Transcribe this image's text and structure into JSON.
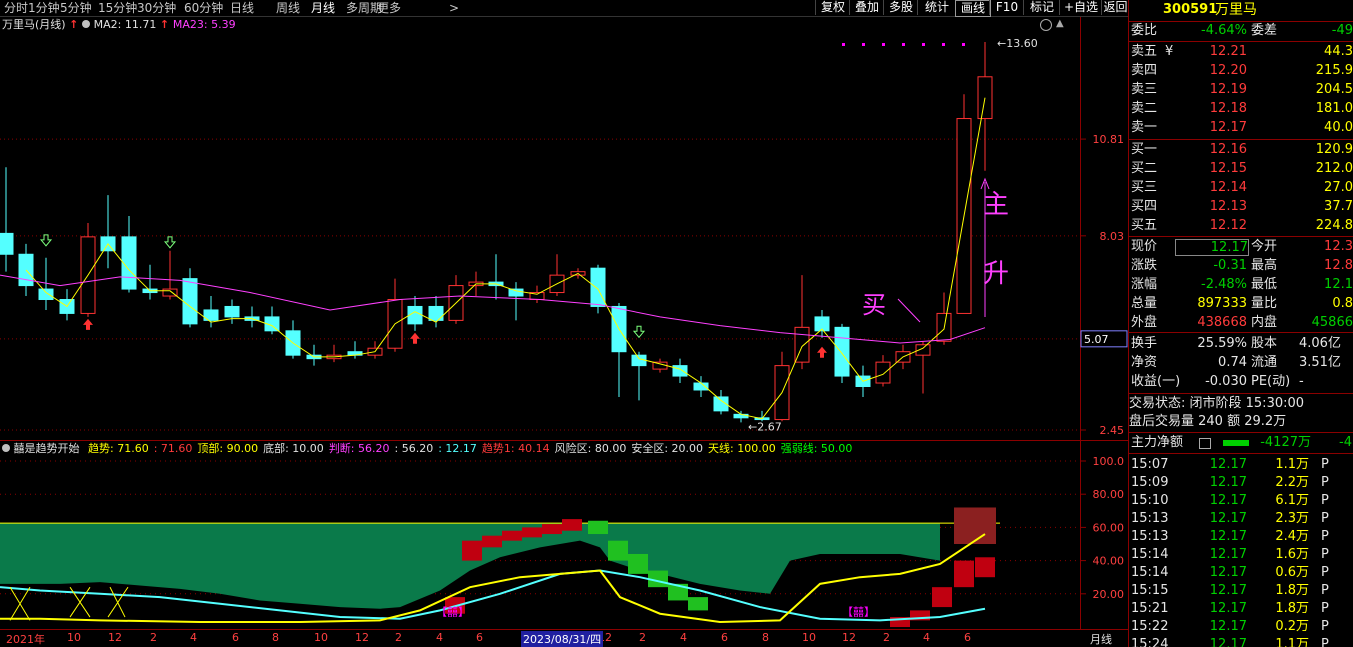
{
  "toolbar": {
    "periods": [
      "分时",
      "1分钟",
      "5分钟",
      "15分钟",
      "30分钟",
      "60分钟",
      "日线",
      "周线",
      "月线",
      "多周期",
      "更多"
    ],
    "selected_period": "月线",
    "right_buttons": [
      "复权",
      "叠加",
      "多股",
      "统计",
      "画线",
      "F10",
      "标记",
      "+自选",
      "返回"
    ],
    "selected_right": "画线"
  },
  "main_chart": {
    "stock_title": "万里马(月线)",
    "ma2_label": "MA2: 11.71",
    "ma23_label": "MA23: 5.39",
    "y_ticks": [
      "10.81",
      "8.03",
      "5.07",
      "2.45"
    ],
    "current_price_tag": "5.07",
    "high_label": "13.60",
    "low_label": "2.67",
    "annotation_buy": "买",
    "annotation_zhu": "主",
    "annotation_sheng": "升",
    "colors": {
      "up": "#ff3232",
      "down": "#54ffff",
      "ma2": "#ffff00",
      "ma23": "#ff40ff",
      "grid": "#8b0000"
    }
  },
  "chart_data": {
    "type": "candlestick",
    "title": "万里马(月线)",
    "series": [
      {
        "name": "MA2",
        "value": 11.71
      },
      {
        "name": "MA23",
        "value": 5.39
      }
    ],
    "high": 13.6,
    "low": 2.67,
    "ylim": [
      2.45,
      13.6
    ]
  },
  "indicator": {
    "title": "囍是趋势开始",
    "items": [
      {
        "text": "趋势: 71.60",
        "color": "#ffff00"
      },
      {
        "text": ": 71.60",
        "color": "#ff3b3b"
      },
      {
        "text": "顶部: 90.00",
        "color": "#ffff00"
      },
      {
        "text": "底部: 10.00",
        "color": "#e0e0e0"
      },
      {
        "text": "判断: 56.20",
        "color": "#ff40ff"
      },
      {
        "text": ": 56.20",
        "color": "#e0e0e0"
      },
      {
        "text": ": 12.17",
        "color": "#54ffff"
      },
      {
        "text": "趋势1: 40.14",
        "color": "#ff3b3b"
      },
      {
        "text": "风险区: 80.00",
        "color": "#e0e0e0"
      },
      {
        "text": "安全区: 20.00",
        "color": "#e0e0e0"
      },
      {
        "text": "天线: 100.00",
        "color": "#ffff00"
      },
      {
        "text": "强弱线: 50.00",
        "color": "#00ff00"
      }
    ],
    "y_ticks": [
      "100.0",
      "80.00",
      "60.00",
      "40.00",
      "20.00"
    ],
    "marker_text": "【囍】"
  },
  "x_axis": {
    "labels": [
      "2021年",
      "10",
      "12",
      "2",
      "4",
      "6",
      "8",
      "10",
      "12",
      "2",
      "4",
      "6",
      "8",
      "10",
      "12",
      "2",
      "4",
      "6",
      "8",
      "10",
      "12",
      "2",
      "4",
      "6"
    ],
    "cursor_label": "2023/08/31/四",
    "period_label": "月线"
  },
  "quote": {
    "code": "300591",
    "name": "万里马",
    "weibi_label": "委比",
    "weibi_value": "-4.64%",
    "weicha_label": "委差",
    "weicha_value": "-49",
    "asks": [
      {
        "label": "卖五",
        "price": "12.21",
        "vol": "44.3"
      },
      {
        "label": "卖四",
        "price": "12.20",
        "vol": "215.9"
      },
      {
        "label": "卖三",
        "price": "12.19",
        "vol": "204.5"
      },
      {
        "label": "卖二",
        "price": "12.18",
        "vol": "181.0"
      },
      {
        "label": "卖一",
        "price": "12.17",
        "vol": "40.0"
      }
    ],
    "ask_currency": "¥",
    "bids": [
      {
        "label": "买一",
        "price": "12.16",
        "vol": "120.9"
      },
      {
        "label": "买二",
        "price": "12.15",
        "vol": "212.0"
      },
      {
        "label": "买三",
        "price": "12.14",
        "vol": "27.0"
      },
      {
        "label": "买四",
        "price": "12.13",
        "vol": "37.7"
      },
      {
        "label": "买五",
        "price": "12.12",
        "vol": "224.8"
      }
    ],
    "stats": [
      {
        "l1": "现价",
        "v1": "12.17",
        "l2": "今开",
        "v2": "12.3",
        "c1": "green",
        "c2": "red"
      },
      {
        "l1": "涨跌",
        "v1": "-0.31",
        "l2": "最高",
        "v2": "12.8",
        "c1": "green",
        "c2": "red"
      },
      {
        "l1": "涨幅",
        "v1": "-2.48%",
        "l2": "最低",
        "v2": "12.1",
        "c1": "green",
        "c2": "green"
      },
      {
        "l1": "总量",
        "v1": "897333",
        "l2": "量比",
        "v2": "0.8",
        "c1": "yellow",
        "c2": "yellow"
      },
      {
        "l1": "外盘",
        "v1": "438668",
        "l2": "内盘",
        "v2": "45866",
        "c1": "red",
        "c2": "green"
      }
    ],
    "stats2": [
      {
        "l1": "换手",
        "v1": "25.59%",
        "l2": "股本",
        "v2": "4.06亿"
      },
      {
        "l1": "净资",
        "v1": "0.74",
        "l2": "流通",
        "v2": "3.51亿"
      },
      {
        "l1": "收益(一)",
        "v1": "-0.030",
        "l2": "PE(动)",
        "v2": "-"
      }
    ],
    "trade_status": "交易状态: 闭市阶段 15:30:00",
    "after_hours": "盘后交易量 240 额 29.2万",
    "main_net_label": "主力净额",
    "main_net_value": "-4127万",
    "main_net_value2": "-4",
    "ticks": [
      {
        "time": "15:07",
        "price": "12.17",
        "vol": "1.1万",
        "flag": "P"
      },
      {
        "time": "15:09",
        "price": "12.17",
        "vol": "2.2万",
        "flag": "P"
      },
      {
        "time": "15:10",
        "price": "12.17",
        "vol": "6.1万",
        "flag": "P"
      },
      {
        "time": "15:13",
        "price": "12.17",
        "vol": "2.3万",
        "flag": "P"
      },
      {
        "time": "15:13",
        "price": "12.17",
        "vol": "2.4万",
        "flag": "P"
      },
      {
        "time": "15:14",
        "price": "12.17",
        "vol": "1.6万",
        "flag": "P"
      },
      {
        "time": "15:14",
        "price": "12.17",
        "vol": "0.6万",
        "flag": "P"
      },
      {
        "time": "15:15",
        "price": "12.17",
        "vol": "1.8万",
        "flag": "P"
      },
      {
        "time": "15:21",
        "price": "12.17",
        "vol": "1.8万",
        "flag": "P"
      },
      {
        "time": "15:22",
        "price": "12.17",
        "vol": "0.2万",
        "flag": "P"
      },
      {
        "time": "15:24",
        "price": "12.17",
        "vol": "1.1万",
        "flag": "P"
      }
    ]
  }
}
